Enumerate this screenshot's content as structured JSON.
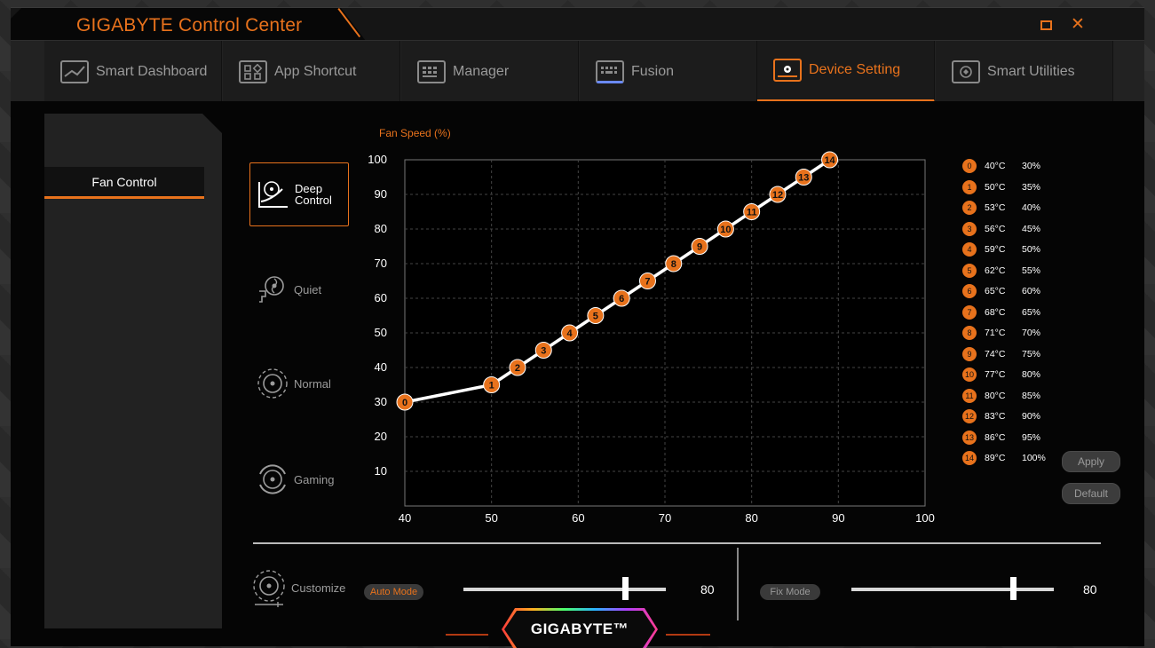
{
  "app": {
    "title": "GIGABYTE Control Center",
    "brand_logo": "GIGABYTE™"
  },
  "tabs": [
    {
      "label": "Smart Dashboard",
      "icon": "dashboard-icon"
    },
    {
      "label": "App Shortcut",
      "icon": "app-shortcut-icon"
    },
    {
      "label": "Manager",
      "icon": "manager-icon"
    },
    {
      "label": "Fusion",
      "icon": "keyboard-icon"
    },
    {
      "label": "Device Setting",
      "icon": "laptop-gear-icon",
      "active": true
    },
    {
      "label": "Smart Utilities",
      "icon": "utilities-icon"
    }
  ],
  "sidebar": {
    "items": [
      {
        "label": "Fan Control",
        "active": true
      }
    ]
  },
  "modes": [
    {
      "label": "Deep Control",
      "label_lines": [
        "Deep",
        "Control"
      ],
      "active": true
    },
    {
      "label": "Quiet"
    },
    {
      "label": "Normal"
    },
    {
      "label": "Gaming"
    }
  ],
  "chart_data": {
    "type": "line",
    "ylabel": "Fan Speed (%)",
    "xlabel": "",
    "xlim": [
      40,
      100
    ],
    "ylim": [
      0,
      100
    ],
    "x_ticks": [
      40,
      50,
      60,
      70,
      80,
      90,
      100
    ],
    "y_ticks": [
      10,
      20,
      30,
      40,
      50,
      60,
      70,
      80,
      90,
      100
    ],
    "grid": true,
    "points": [
      {
        "id": "0",
        "temp": 40,
        "speed": 30
      },
      {
        "id": "1",
        "temp": 50,
        "speed": 35
      },
      {
        "id": "2",
        "temp": 53,
        "speed": 40
      },
      {
        "id": "3",
        "temp": 56,
        "speed": 45
      },
      {
        "id": "4",
        "temp": 59,
        "speed": 50
      },
      {
        "id": "5",
        "temp": 62,
        "speed": 55
      },
      {
        "id": "6",
        "temp": 65,
        "speed": 60
      },
      {
        "id": "7",
        "temp": 68,
        "speed": 65
      },
      {
        "id": "8",
        "temp": 71,
        "speed": 70
      },
      {
        "id": "9",
        "temp": 74,
        "speed": 75
      },
      {
        "id": "10",
        "temp": 77,
        "speed": 80
      },
      {
        "id": "11",
        "temp": 80,
        "speed": 85
      },
      {
        "id": "12",
        "temp": 83,
        "speed": 90
      },
      {
        "id": "13",
        "temp": 86,
        "speed": 95
      },
      {
        "id": "14",
        "temp": 89,
        "speed": 100
      }
    ]
  },
  "legend": [
    {
      "id": "0",
      "temp": "40°C",
      "pct": "30%"
    },
    {
      "id": "1",
      "temp": "50°C",
      "pct": "35%"
    },
    {
      "id": "2",
      "temp": "53°C",
      "pct": "40%"
    },
    {
      "id": "3",
      "temp": "56°C",
      "pct": "45%"
    },
    {
      "id": "4",
      "temp": "59°C",
      "pct": "50%"
    },
    {
      "id": "5",
      "temp": "62°C",
      "pct": "55%"
    },
    {
      "id": "6",
      "temp": "65°C",
      "pct": "60%"
    },
    {
      "id": "7",
      "temp": "68°C",
      "pct": "65%"
    },
    {
      "id": "8",
      "temp": "71°C",
      "pct": "70%"
    },
    {
      "id": "9",
      "temp": "74°C",
      "pct": "75%"
    },
    {
      "id": "10",
      "temp": "77°C",
      "pct": "80%"
    },
    {
      "id": "11",
      "temp": "80°C",
      "pct": "85%"
    },
    {
      "id": "12",
      "temp": "83°C",
      "pct": "90%"
    },
    {
      "id": "13",
      "temp": "86°C",
      "pct": "95%"
    },
    {
      "id": "14",
      "temp": "89°C",
      "pct": "100%"
    }
  ],
  "buttons": {
    "apply": "Apply",
    "default": "Default"
  },
  "customize": {
    "label": "Customize",
    "auto_mode": {
      "label": "Auto Mode",
      "value": 80,
      "value_text": "80",
      "min": 0,
      "max": 100
    },
    "fix_mode": {
      "label": "Fix Mode",
      "value": 80,
      "value_text": "80",
      "min": 0,
      "max": 100
    }
  },
  "colors": {
    "accent": "#e8721c",
    "background": "#050505",
    "panel": "#222222",
    "text": "#ffffff",
    "muted": "#9a9a9a"
  }
}
